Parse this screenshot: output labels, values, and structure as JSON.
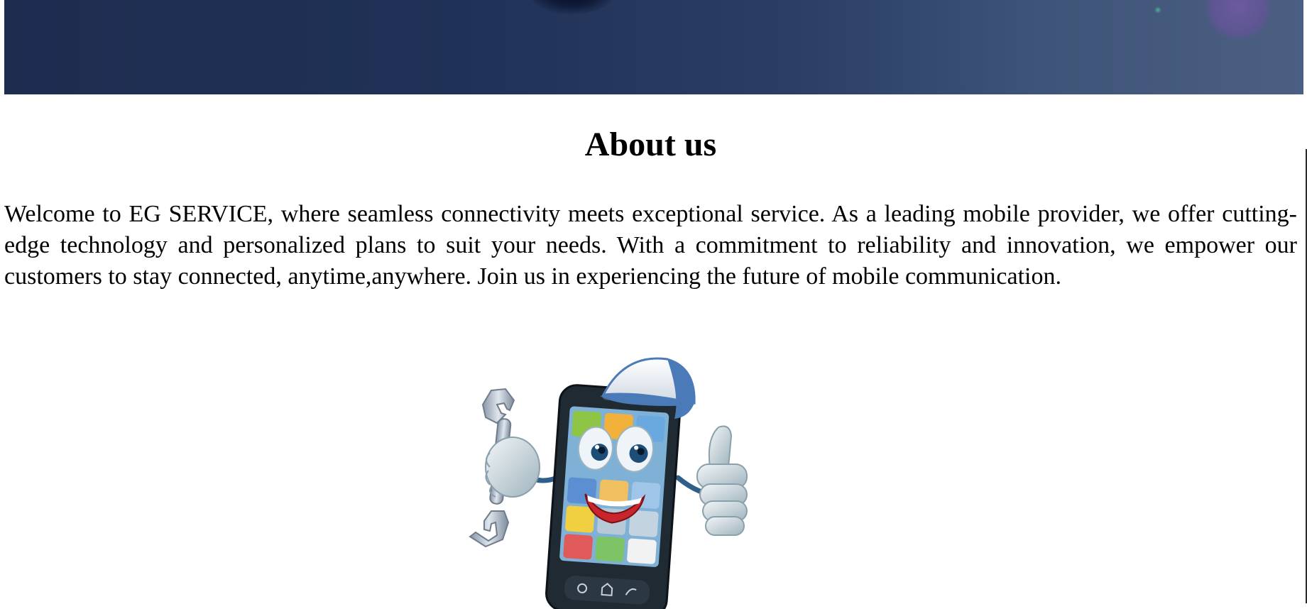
{
  "about": {
    "heading": "About us",
    "body": "Welcome to EG SERVICE, where seamless connectivity meets exceptional service. As a leading mobile provider, we offer cutting-edge technology and personalized plans to suit your needs. With a commitment to reliability and innovation, we empower our customers to stay connected, anytime,anywhere. Join us in experiencing the future of mobile communication."
  },
  "colors": {
    "banner_dark": "#1d2c4f",
    "banner_light": "#4b5f82",
    "phone_body": "#1f2a33",
    "cap": "#4a7bb8"
  },
  "icons": {
    "mascot": "phone-repair-mascot-icon"
  }
}
